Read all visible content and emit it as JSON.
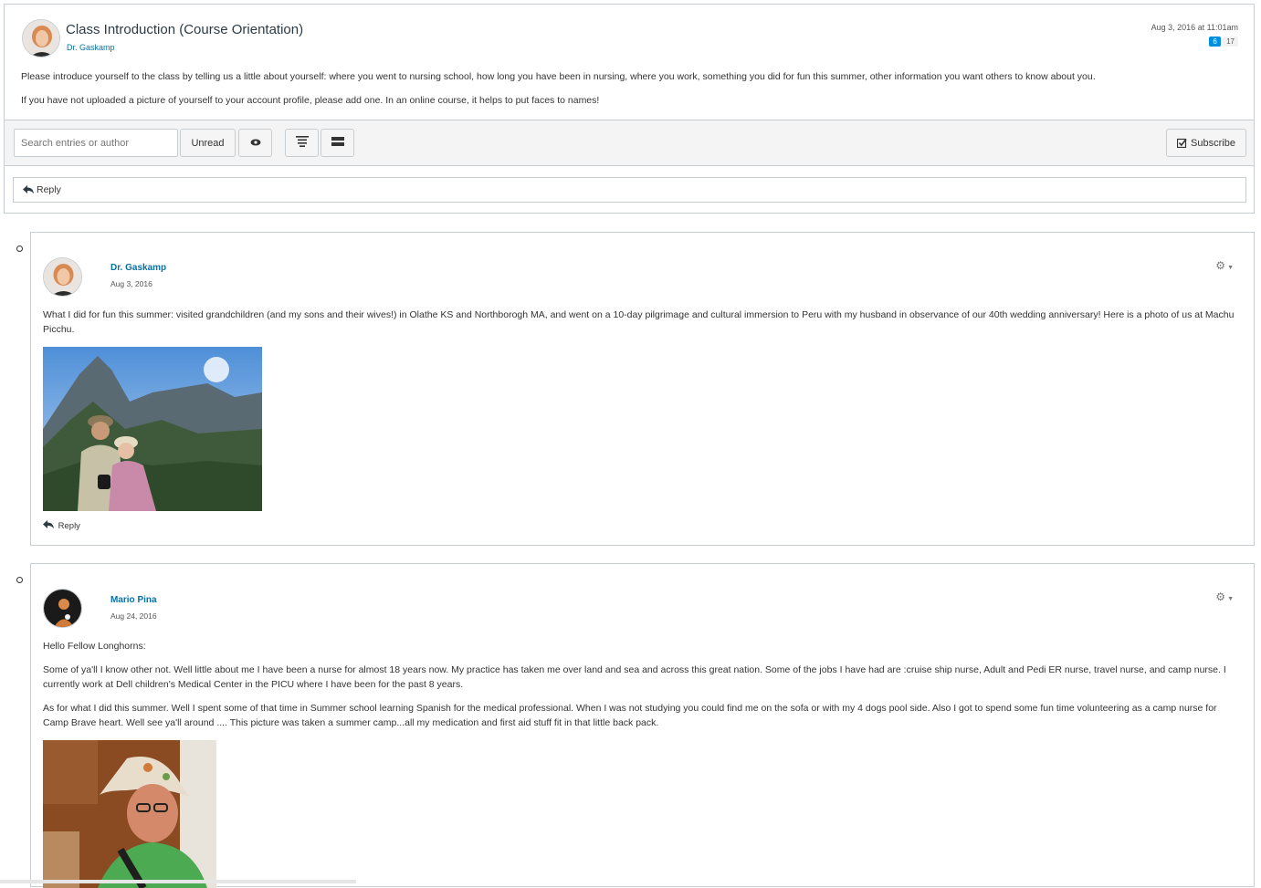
{
  "topic": {
    "title": "Class Introduction (Course Orientation)",
    "author": "Dr. Gaskamp",
    "date": "Aug 3, 2016 at 11:01am",
    "unread_count": "6",
    "total_count": "17",
    "message_p1": "Please introduce yourself to the class by telling us a little about yourself: where you went to nursing school, how long you have been in nursing, where you work, something you did for fun this summer, other information you want others to know about you.",
    "message_p2": "If you have not uploaded a picture of yourself to your account profile, please add one. In an online course, it helps to put faces to names!"
  },
  "toolbar": {
    "search_placeholder": "Search entries or author",
    "unread_label": "Unread",
    "subscribe_label": "Subscribe"
  },
  "reply_label": "Reply",
  "entries": [
    {
      "author": "Dr. Gaskamp",
      "date": "Aug 3, 2016",
      "paragraphs": [
        "What I did for fun this summer: visited grandchildren (and my sons and their wives!) in Olathe KS and Northborogh MA, and went on a 10-day pilgrimage and cultural immersion to Peru with my husband in observance of our 40th wedding anniversary! Here is a photo of us at Machu Picchu."
      ],
      "reply_label": "Reply"
    },
    {
      "author": "Mario Pina",
      "date": "Aug 24, 2016",
      "paragraphs": [
        "Hello Fellow Longhorns:",
        "Some of ya'll I know other not. Well little about me I have been a nurse for almost 18 years now.  My practice has taken me over land and sea and across this great nation. Some of the jobs I have had are :cruise ship nurse, Adult and Pedi ER nurse, travel nurse, and camp nurse.  I currently work at Dell children's Medical Center in the PICU where I have been for the past 8 years.",
        "As for what I did this summer. Well I spent some of that time in Summer school learning Spanish for the medical professional. When I was not studying you  could find me on the sofa or with my 4 dogs pool side.  Also I got to spend some fun time volunteering as a camp nurse for Camp Brave heart. Well see ya'll around .... This picture was taken a summer camp...all my medication and first aid stuff fit in that little back pack."
      ]
    }
  ]
}
